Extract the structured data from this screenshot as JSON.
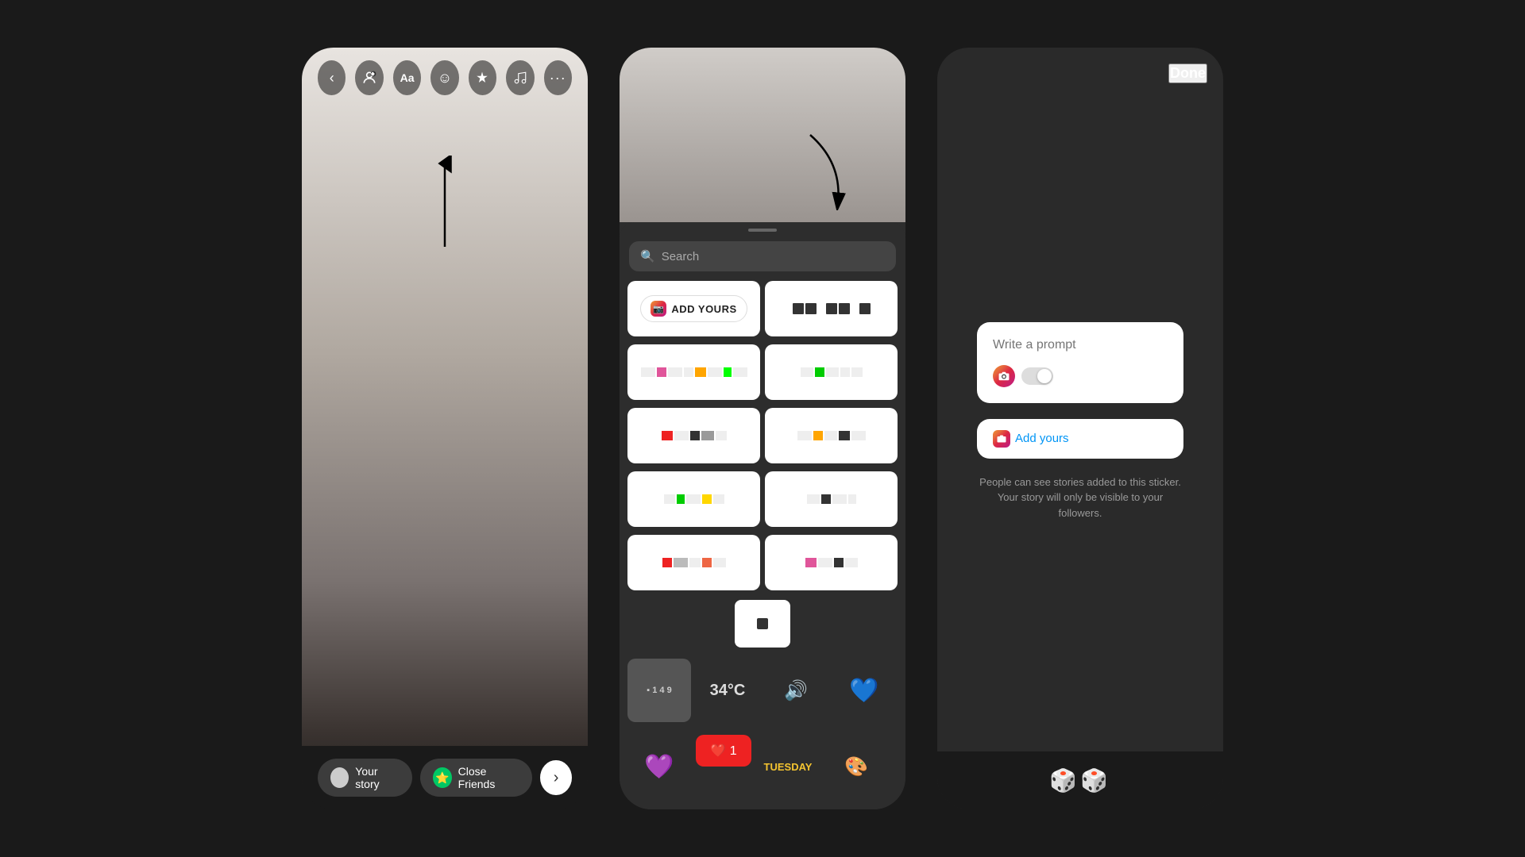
{
  "page": {
    "background_color": "#1a1a1a"
  },
  "phone1": {
    "toolbar": {
      "back_icon": "‹",
      "person_icon": "👤",
      "text_icon": "Aa",
      "emoji_icon": "☺",
      "sparkle_icon": "✦",
      "music_icon": "♪",
      "more_icon": "•••"
    },
    "bottom": {
      "your_story_label": "Your story",
      "close_friends_label": "Close Friends",
      "next_icon": "›"
    }
  },
  "phone2": {
    "search": {
      "placeholder": "Search"
    },
    "add_yours_badge": {
      "icon": "📷",
      "label": "ADD YOURS"
    },
    "bottom_stickers": [
      {
        "label": "🕹️149",
        "type": "counter"
      },
      {
        "label": "34°C",
        "type": "temp"
      },
      {
        "label": "🔊 SOUND ON",
        "type": "sound"
      },
      {
        "label": "💙",
        "type": "heart"
      }
    ]
  },
  "phone3": {
    "header": {
      "done_label": "Done"
    },
    "prompt_card": {
      "placeholder": "Write a prompt",
      "toggle_state": "off"
    },
    "add_yours_label": "Add yours",
    "info_text": "People can see stories added to this sticker.\nYour story will only be visible to your followers.",
    "bottom": {
      "dice_icon": "🎲🎲"
    }
  }
}
